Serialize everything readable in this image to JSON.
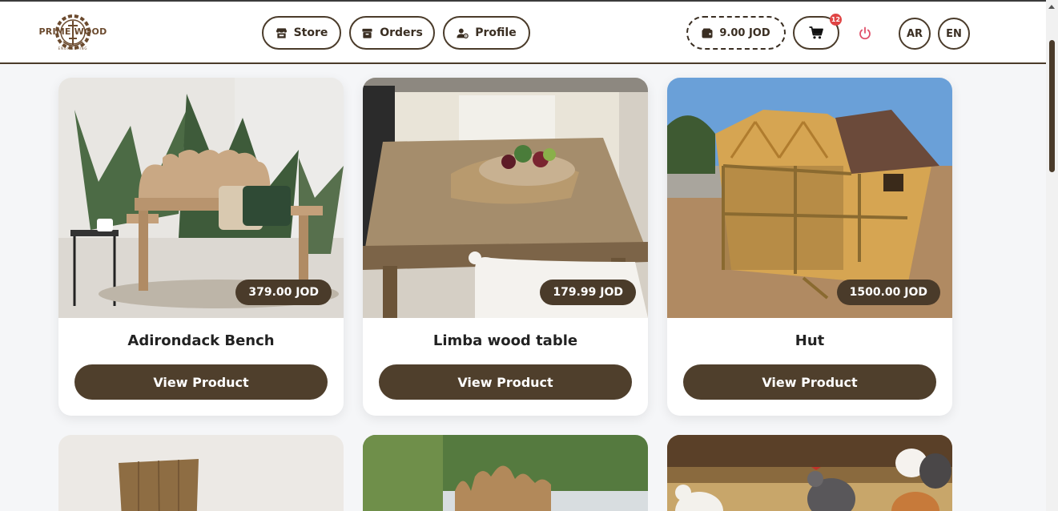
{
  "brand": {
    "name": "PRIME WOOD",
    "tagline": "ENGINEERING"
  },
  "nav": {
    "store": "Store",
    "orders": "Orders",
    "profile": "Profile"
  },
  "wallet": {
    "balance": "9.00 JOD"
  },
  "cart": {
    "count": "12"
  },
  "languages": {
    "ar": "AR",
    "en": "EN"
  },
  "products": [
    {
      "name": "Adirondack Bench",
      "price": "379.00 JOD",
      "cta": "View Product"
    },
    {
      "name": "Limba wood table",
      "price": "179.99 JOD",
      "cta": "View Product"
    },
    {
      "name": "Hut",
      "price": "1500.00 JOD",
      "cta": "View Product"
    }
  ],
  "colors": {
    "brand_brown": "#4a3b2a",
    "badge_red": "#e04545",
    "power_red": "#e0506a"
  },
  "icons": [
    "store-icon",
    "orders-icon",
    "profile-icon",
    "wallet-icon",
    "cart-icon",
    "power-icon"
  ]
}
